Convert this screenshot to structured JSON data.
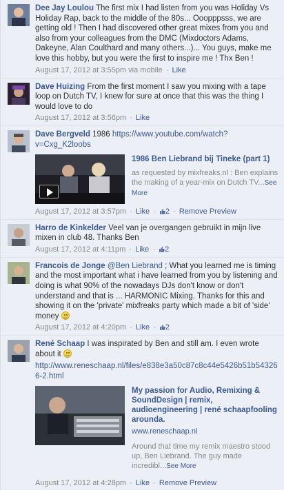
{
  "comments": [
    {
      "author": "Dee Jay Loulou",
      "text": " The first mix I had listen from you was Holiday Vs Holiday Rap, back to the middle of the 80s... Ooopppsss, we are getting old ! Then I had discovered other great mixes from you and also from your colleagues from the DMC (Mixdoctors Adams, Dakeyne, Alan Coulthard and many others...)... You guys, make me love this hobby, but you were the first to inspire me ! Thx Ben !",
      "timestamp": "August 17, 2012 at 3:55pm",
      "via": " via mobile",
      "like": "Like"
    },
    {
      "author": "Dave Huizing",
      "text": " From the first moment I saw you mixing with a tape loop on Dutch TV, I knew for sure at once that this was the thing I would love to do",
      "timestamp": "August 17, 2012 at 3:56pm",
      "like": "Like"
    },
    {
      "author": "Dave Bergveld",
      "text": " 1986 ",
      "url": "https://www.youtube.com/watch?v=Cxg_K2loobs",
      "preview_title": "1986 Ben Liebrand bij Tineke (part 1)",
      "preview_desc": "as requested by mixfreaks.nl : Ben explains the making of a year-mix on Dutch TV...",
      "see_more": "See More",
      "timestamp": "August 17, 2012 at 3:57pm",
      "like": "Like",
      "likes_count": "2",
      "remove_preview": "Remove Preview"
    },
    {
      "author": "Harro de Kinkelder",
      "text": " Veel van je overgangen gebruikt in mijn live mixen in club 48. Thanks Ben",
      "timestamp": "August 17, 2012 at 4:11pm",
      "like": "Like",
      "likes_count": "2"
    },
    {
      "author": "Francois de Jonge",
      "mention": "@Ben Liebrand",
      "text": " ; What you learned me is timing and the most important what i have learned from you by listening and doing is what 90% of the nowadays DJs don't know or don't understand and that is ... HARMONIC Mixing. Thanks for this and showing it on the 'private' mixfreaks party which made a bit of 'side' money ",
      "timestamp": "August 17, 2012 at 4:20pm",
      "like": "Like",
      "likes_count": "2"
    },
    {
      "author": "René Schaap",
      "text": " I was inspirated by Ben and still am. I even wrote about it ",
      "url": "http://www.reneschaap.nl/files/e838e3a50c87c8c44e5426b51b543266-2.html",
      "preview_title": "My passion for Audio, Remixing & SoundDesign | remix, audioengineering | rené schaapfooling arounda.",
      "preview_domain": "www.reneschaap.nl",
      "preview_desc": "Around that time my remix maestro stood up, Ben Liebrand. The guy made incredibl...",
      "see_more": "See More",
      "timestamp": "August 17, 2012 at 4:28pm",
      "like": "Like",
      "remove_preview": "Remove Preview"
    }
  ],
  "separator": "·",
  "colors": {
    "link": "#3b5998",
    "meta": "#888888",
    "background": "#edeff4"
  }
}
